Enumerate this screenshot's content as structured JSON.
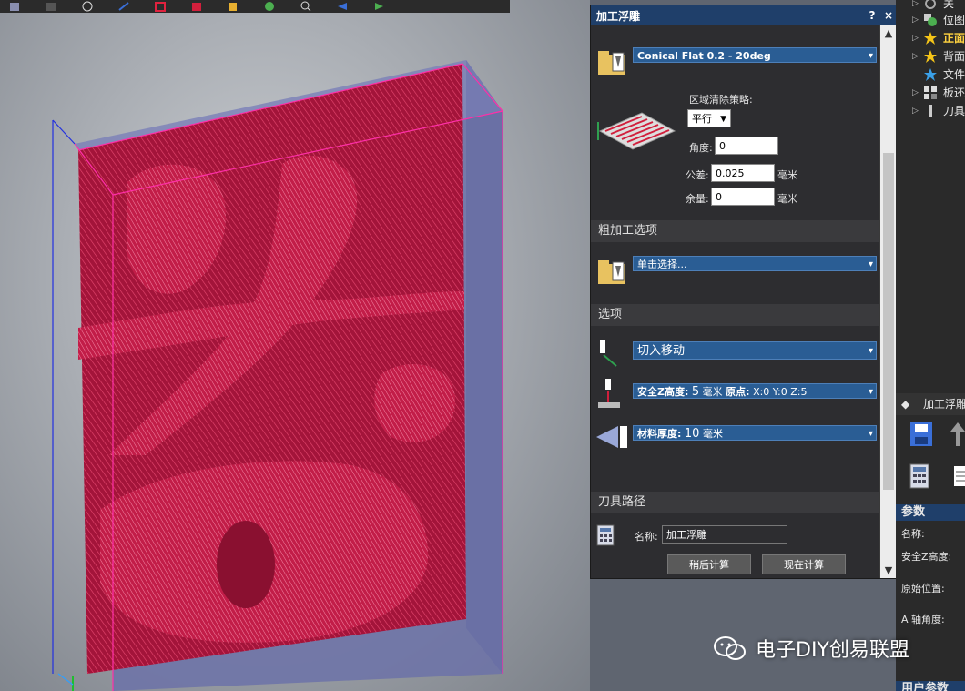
{
  "toolbar": {
    "buttons": [
      "box-view-icon",
      "shaded-icon",
      "circle-icon",
      "axis-icon",
      "red-box-icon",
      "red-solid-icon",
      "paint-icon",
      "green-icon",
      "zoom-icon",
      "arrow-icon",
      "flag-icon"
    ]
  },
  "dialog": {
    "title": "加工浮雕",
    "help": "?",
    "close": "×",
    "tool": "Conical Flat 0.2 - 20deg",
    "strategy_label": "区域清除策略:",
    "strategy_value": "平行",
    "angle_label": "角度:",
    "angle_value": "0",
    "tolerance_label": "公差:",
    "tolerance_value": "0.025",
    "tolerance_unit": "毫米",
    "allowance_label": "余量:",
    "allowance_value": "0",
    "allowance_unit": "毫米",
    "rough_header": "粗加工选项",
    "rough_tool": "单击选择...",
    "options_header": "选项",
    "lead_in": "切入移动",
    "safe_z_label": "安全Z高度:",
    "safe_z_value": "5",
    "safe_z_unit": "毫米",
    "origin_label": "原点:",
    "origin_value": "X:0 Y:0 Z:5",
    "material_label": "材料厚度:",
    "material_value": "10",
    "material_unit": "毫米",
    "toolpath_header": "刀具路径",
    "name_label": "名称:",
    "name_value": "加工浮雕",
    "calc_later": "稍后计算",
    "calc_now": "现在计算"
  },
  "right_panel": {
    "tree": [
      {
        "label": "关",
        "icon": "gear-icon"
      },
      {
        "label": "位图",
        "icon": "circle-icon"
      },
      {
        "label": "正面",
        "icon": "star-icon"
      },
      {
        "label": "背面",
        "icon": "star-icon"
      },
      {
        "label": "文件",
        "icon": "star-blue-icon"
      },
      {
        "label": "板还",
        "icon": "grid-icon"
      },
      {
        "label": "刀具",
        "icon": "tool-icon"
      }
    ],
    "panel_title": "加工浮雕",
    "params_header": "参数",
    "param_name": "名称:",
    "param_safe_z": "安全Z高度:",
    "param_origin": "原始位置:",
    "param_a_axis": "A 轴角度:",
    "user_params": "用户参数"
  },
  "watermark": {
    "text": "电子DIY创易联盟"
  },
  "colors": {
    "relief": "#b8183f",
    "block": "#6c72a8",
    "dialog_title": "#1f3f6a",
    "dropdown": "#2a5d94",
    "panel_bg": "#2d2d30"
  }
}
